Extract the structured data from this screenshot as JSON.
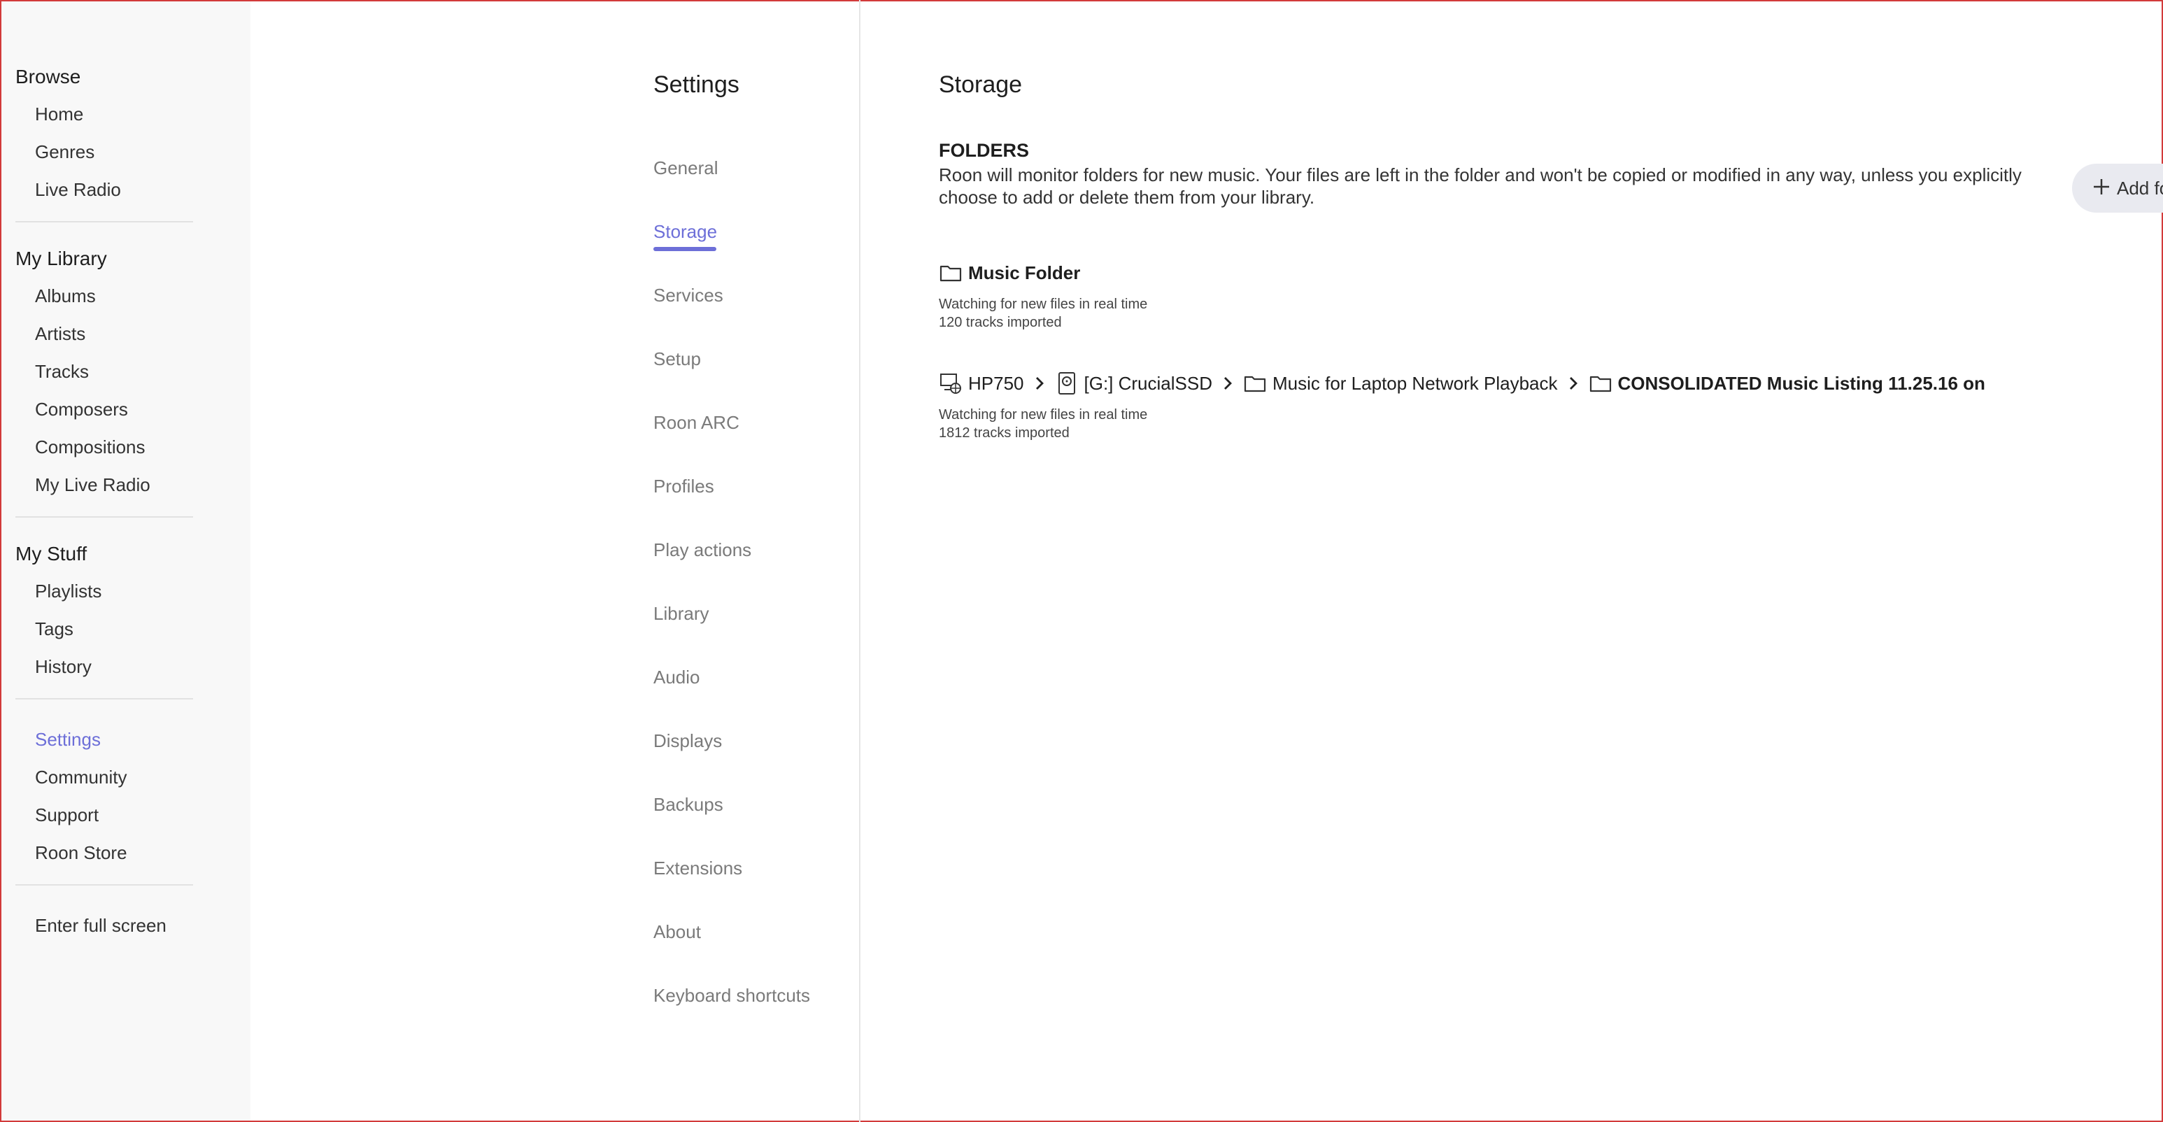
{
  "sidebar": {
    "browse": {
      "title": "Browse",
      "items": [
        "Home",
        "Genres",
        "Live Radio"
      ]
    },
    "library": {
      "title": "My Library",
      "items": [
        "Albums",
        "Artists",
        "Tracks",
        "Composers",
        "Compositions",
        "My Live Radio"
      ]
    },
    "stuff": {
      "title": "My Stuff",
      "items": [
        "Playlists",
        "Tags",
        "History"
      ]
    },
    "misc": {
      "items": [
        "Settings",
        "Community",
        "Support",
        "Roon Store"
      ]
    },
    "fullscreen": "Enter full screen"
  },
  "settings": {
    "title": "Settings",
    "items": [
      "General",
      "Storage",
      "Services",
      "Setup",
      "Roon ARC",
      "Profiles",
      "Play actions",
      "Library",
      "Audio",
      "Displays",
      "Backups",
      "Extensions",
      "About",
      "Keyboard shortcuts"
    ]
  },
  "storage": {
    "title": "Storage",
    "folders_heading": "FOLDERS",
    "folders_desc": "Roon will monitor folders for new music. Your files are left in the folder and won't be copied or modified in any way, unless you explicitly choose to add or delete them from your library.",
    "add_button": "Add fo",
    "folders": [
      {
        "name": "Music Folder",
        "status": "Watching for new files in real time",
        "count": "120 tracks imported"
      },
      {
        "path": [
          "HP750",
          "[G:] CrucialSSD",
          "Music for Laptop Network Playback",
          "CONSOLIDATED Music Listing 11.25.16 on"
        ],
        "status": "Watching for new files in real time",
        "count": "1812 tracks imported"
      }
    ]
  },
  "colors": {
    "accent": "#6d6fd8",
    "sidebar_bg": "#f8f8f8",
    "button_bg": "#e9eaf0"
  }
}
